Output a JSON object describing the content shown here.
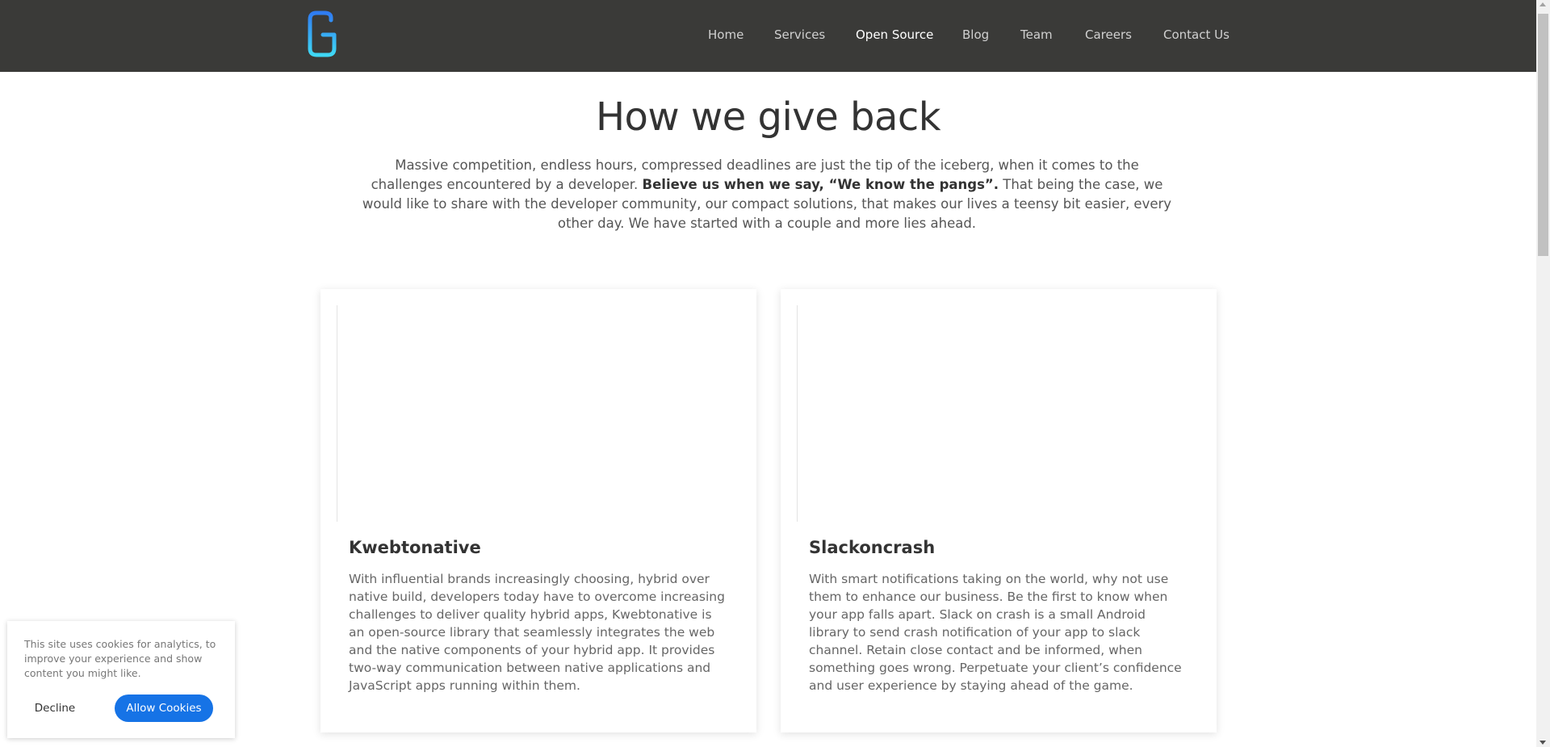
{
  "nav": {
    "logo_icon": "g-logo-icon",
    "items": [
      {
        "label": "Home",
        "active": false
      },
      {
        "label": "Services",
        "active": false
      },
      {
        "label": "Open Source",
        "active": true
      },
      {
        "label": "Blog",
        "active": false
      },
      {
        "label": "Team",
        "active": false
      },
      {
        "label": "Careers",
        "active": false
      },
      {
        "label": "Contact Us",
        "active": false
      }
    ]
  },
  "hero": {
    "title": "How we give back",
    "intro_part1": "Massive competition, endless hours, compressed deadlines are just the tip of the iceberg, when it comes to the challenges encountered by a developer.",
    "intro_bold": "Believe us when we say, “We know the pangs”.",
    "intro_part2": "That being the case, we would like to share with the developer community, our compact solutions, that makes our lives a teensy bit easier, every other day. We have started with a couple and more lies ahead."
  },
  "projects": [
    {
      "title": "Kwebtonative",
      "description": "With influential brands increasingly choosing, hybrid over native build, developers today have to overcome increasing challenges to deliver quality hybrid apps, Kwebtonative is an open-source library that seamlessly integrates the web and the native components of your hybrid app. It provides two-way communication between native applications and JavaScript apps running within them."
    },
    {
      "title": "Slackoncrash",
      "description": "With smart notifications taking on the world, why not use them to enhance our business. Be the first to know when your app falls apart. Slack on crash is a small Android library to send crash notification of your app to slack channel. Retain close contact and be informed, when something goes wrong. Perpetuate your client’s confidence and user experience by staying ahead of the game."
    }
  ],
  "cookie": {
    "message": "This site uses cookies for analytics, to improve your experience and show content you might like.",
    "decline_label": "Decline",
    "allow_label": "Allow Cookies"
  },
  "colors": {
    "header_bg": "#3a3a38",
    "accent": "#1673e6",
    "logo_gradient_top": "#2f7cf2",
    "logo_gradient_bottom": "#3fd8f5"
  }
}
